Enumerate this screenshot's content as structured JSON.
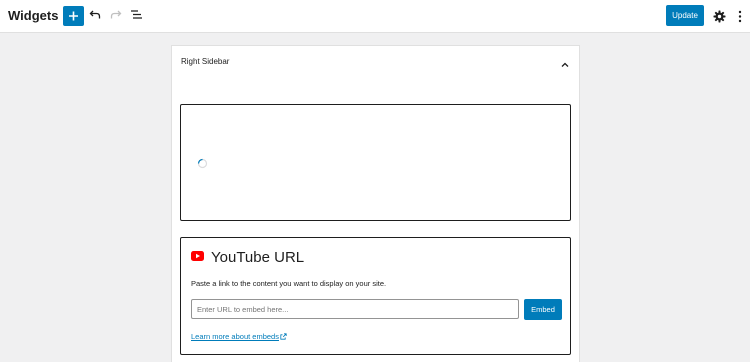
{
  "header": {
    "title": "Widgets",
    "update_label": "Update",
    "icons": [
      "plus-icon",
      "undo-icon",
      "redo-icon",
      "list-view-icon",
      "gear-icon",
      "more-vertical-icon"
    ]
  },
  "sidebar_panel": {
    "title": "Right Sidebar"
  },
  "embed": {
    "title": "YouTube URL",
    "instructions": "Paste a link to the content you want to display on your site.",
    "placeholder": "Enter URL to embed here...",
    "embed_label": "Embed",
    "learn_more": "Learn more about embeds"
  },
  "colors": {
    "accent": "#007cba",
    "youtube": "#ff0000",
    "background": "#f0f0f1"
  }
}
